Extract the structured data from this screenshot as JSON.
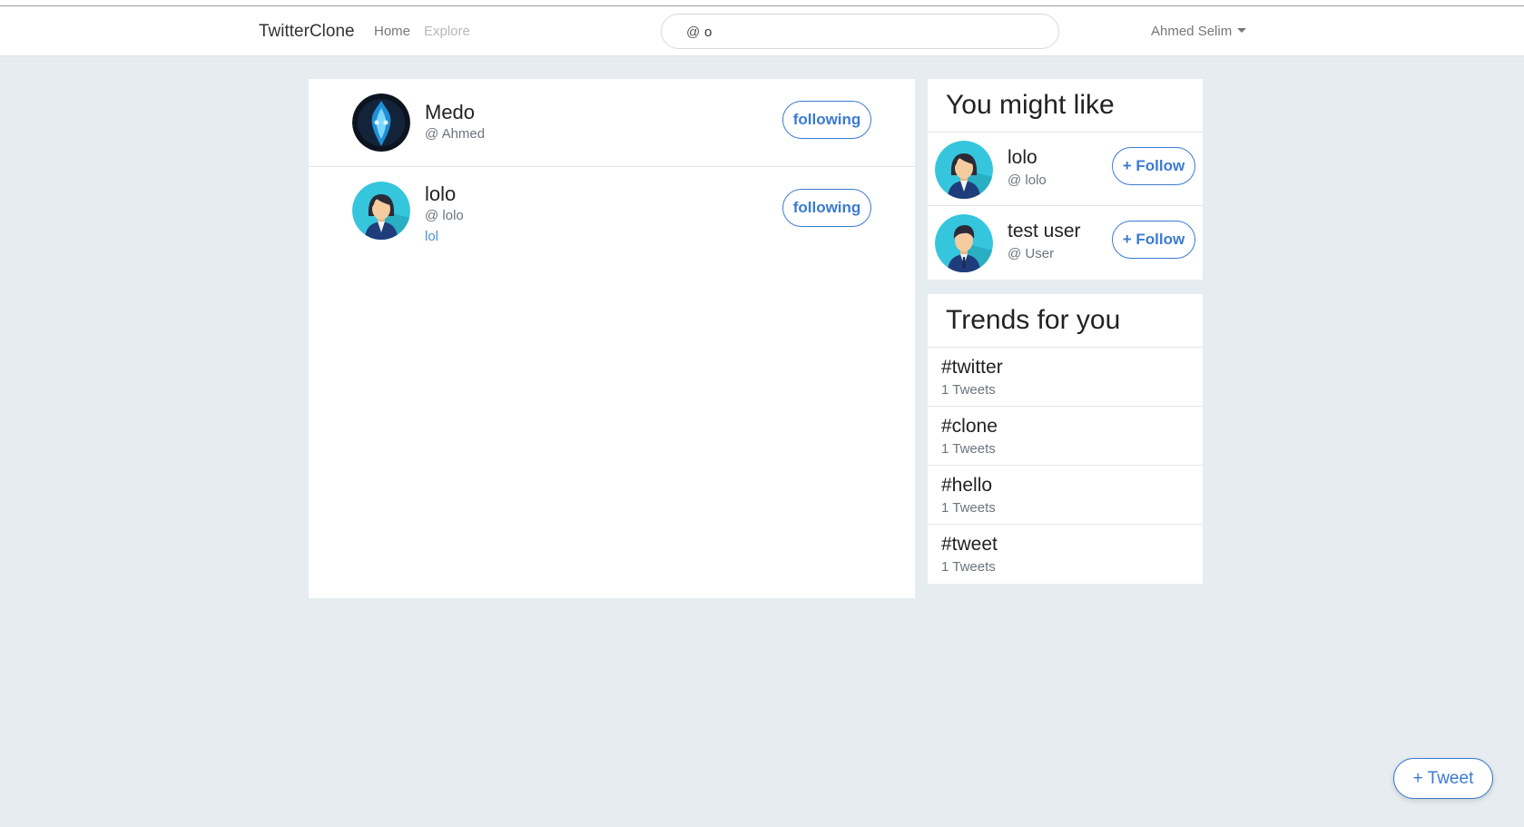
{
  "nav": {
    "brand": "TwitterClone",
    "home": "Home",
    "explore": "Explore",
    "search_prefix": "@",
    "search_value": "o",
    "user": "Ahmed Selim"
  },
  "following_list": [
    {
      "name": "Medo",
      "handle": "@ Ahmed",
      "bio": "",
      "button": "following",
      "avatar": "dark-emblem-avatar"
    },
    {
      "name": "lolo",
      "handle": "@ lolo",
      "bio": "lol",
      "button": "following",
      "avatar": "female-avatar"
    }
  ],
  "suggestions": {
    "title": "You might like",
    "items": [
      {
        "name": "lolo",
        "handle": "@ lolo",
        "button": "+ Follow",
        "avatar": "female-avatar"
      },
      {
        "name": "test user",
        "handle": "@ User",
        "button": "+ Follow",
        "avatar": "male-avatar"
      }
    ]
  },
  "trends": {
    "title": "Trends for you",
    "items": [
      {
        "tag": "#twitter",
        "count": "1 Tweets"
      },
      {
        "tag": "#clone",
        "count": "1 Tweets"
      },
      {
        "tag": "#hello",
        "count": "1 Tweets"
      },
      {
        "tag": "#tweet",
        "count": "1 Tweets"
      }
    ]
  },
  "tweet_button": "+ Tweet",
  "colors": {
    "accent": "#3b7bd1",
    "background": "#e6ecf0",
    "avatar_bg": "#35c6dd"
  }
}
